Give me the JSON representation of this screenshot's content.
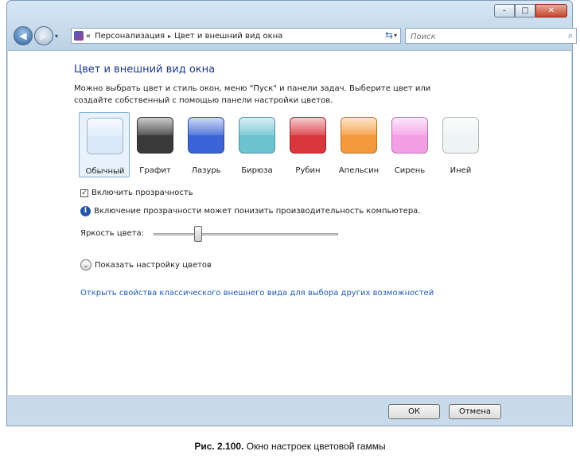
{
  "window": {
    "controls": {
      "minimize": "–",
      "maximize": "□",
      "close": "✕"
    }
  },
  "nav": {
    "back_icon": "back-arrow-icon",
    "forward_icon": "forward-arrow-icon",
    "breadcrumb_prefix": "«",
    "breadcrumb": [
      "Персонализация",
      "Цвет и внешний вид окна"
    ],
    "separator": "▸",
    "dropdown": "▾",
    "refresh": "⇆"
  },
  "search": {
    "placeholder": "Поиск",
    "icon": "⌕"
  },
  "page": {
    "title": "Цвет и внешний вид окна",
    "description": "Можно выбрать цвет и стиль окон, меню \"Пуск\" и панели задач. Выберите цвет или создайте собственный с помощью панели настройки цветов."
  },
  "swatches": [
    {
      "label": "Обычный",
      "color": "#dbeafb",
      "selected": true
    },
    {
      "label": "Графит",
      "color": "#3a3a3a",
      "selected": false
    },
    {
      "label": "Лазурь",
      "color": "#3d64d6",
      "selected": false
    },
    {
      "label": "Бирюза",
      "color": "#6cc3cf",
      "selected": false
    },
    {
      "label": "Рубин",
      "color": "#d8353d",
      "selected": false
    },
    {
      "label": "Апельсин",
      "color": "#f39a3c",
      "selected": false
    },
    {
      "label": "Сирень",
      "color": "#f39fe6",
      "selected": false
    },
    {
      "label": "Иней",
      "color": "#eef3f3",
      "selected": false
    }
  ],
  "transparency": {
    "label": "Включить прозрачность",
    "checked": "✓"
  },
  "info": {
    "icon": "i",
    "text": "Включение прозрачности может понизить производительность компьютера."
  },
  "brightness": {
    "label": "Яркость цвета:",
    "value_fraction": 0.23
  },
  "expand": {
    "icon": "⌄",
    "label": "Показать настройку цветов"
  },
  "link": "Открыть свойства классического внешнего вида для выбора других возможностей",
  "buttons": {
    "ok": "ОК",
    "cancel": "Отмена"
  },
  "caption": {
    "bold": "Рис. 2.100.",
    "text": " Окно настроек цветовой гаммы"
  }
}
